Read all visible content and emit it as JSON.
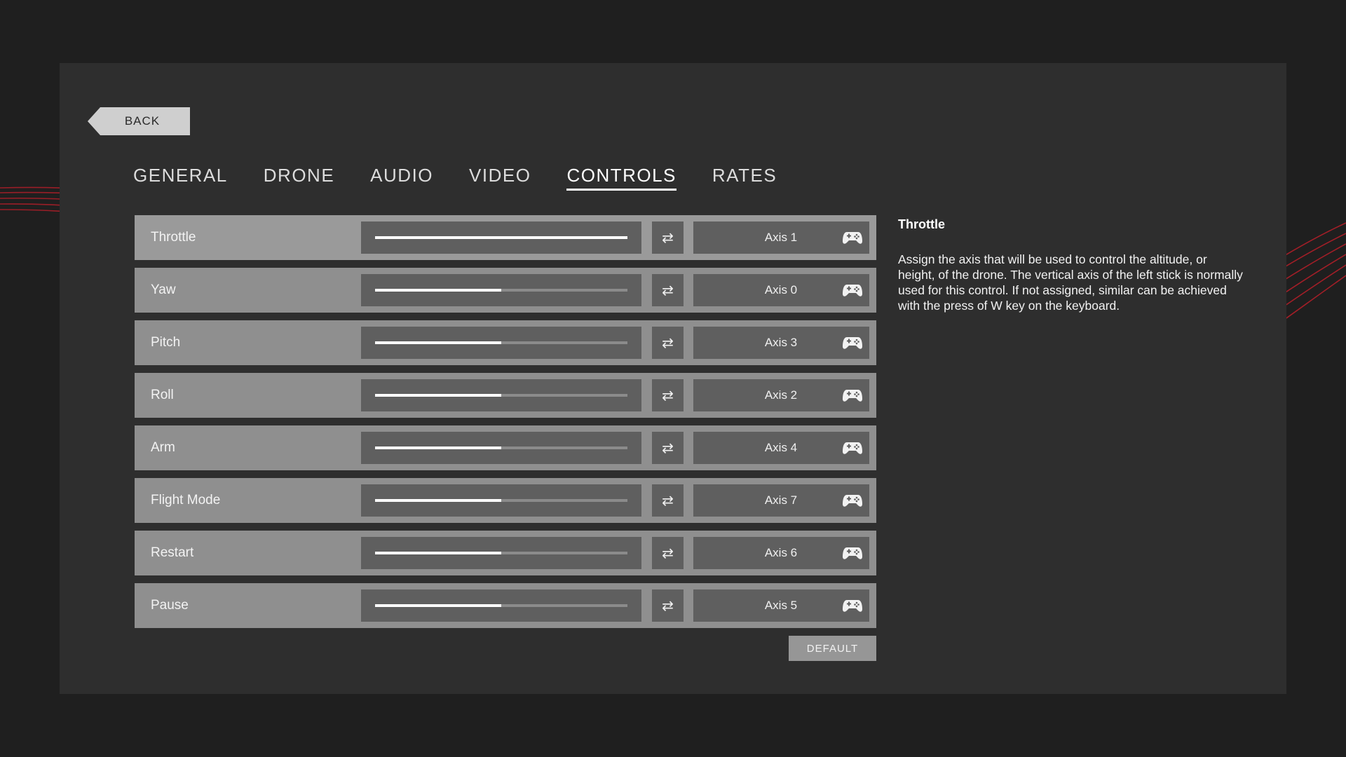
{
  "back_label": "BACK",
  "tabs": [
    {
      "label": "GENERAL",
      "active": false
    },
    {
      "label": "DRONE",
      "active": false
    },
    {
      "label": "AUDIO",
      "active": false
    },
    {
      "label": "VIDEO",
      "active": false
    },
    {
      "label": "CONTROLS",
      "active": true
    },
    {
      "label": "RATES",
      "active": false
    }
  ],
  "controls": [
    {
      "label": "Throttle",
      "level": 1.0,
      "axis": "Axis 1"
    },
    {
      "label": "Yaw",
      "level": 0.5,
      "axis": "Axis 0"
    },
    {
      "label": "Pitch",
      "level": 0.5,
      "axis": "Axis 3"
    },
    {
      "label": "Roll",
      "level": 0.5,
      "axis": "Axis 2"
    },
    {
      "label": "Arm",
      "level": 0.5,
      "axis": "Axis 4"
    },
    {
      "label": "Flight Mode",
      "level": 0.5,
      "axis": "Axis 7"
    },
    {
      "label": "Restart",
      "level": 0.5,
      "axis": "Axis 6"
    },
    {
      "label": "Pause",
      "level": 0.5,
      "axis": "Axis 5"
    }
  ],
  "icons": {
    "invert": "swap-arrows-icon",
    "controller": "gamepad-icon"
  },
  "default_label": "DEFAULT",
  "description": {
    "title": "Throttle",
    "body": "Assign the axis that will be used to control the altitude, or height, of the drone. The vertical axis of the left stick is normally used for this control. If not assigned, similar can be achieved with the press of W key on the keyboard."
  },
  "colors": {
    "accent_red": "#d01f2b",
    "panel": "#2e2e2e",
    "row": "#8f8f8f"
  }
}
